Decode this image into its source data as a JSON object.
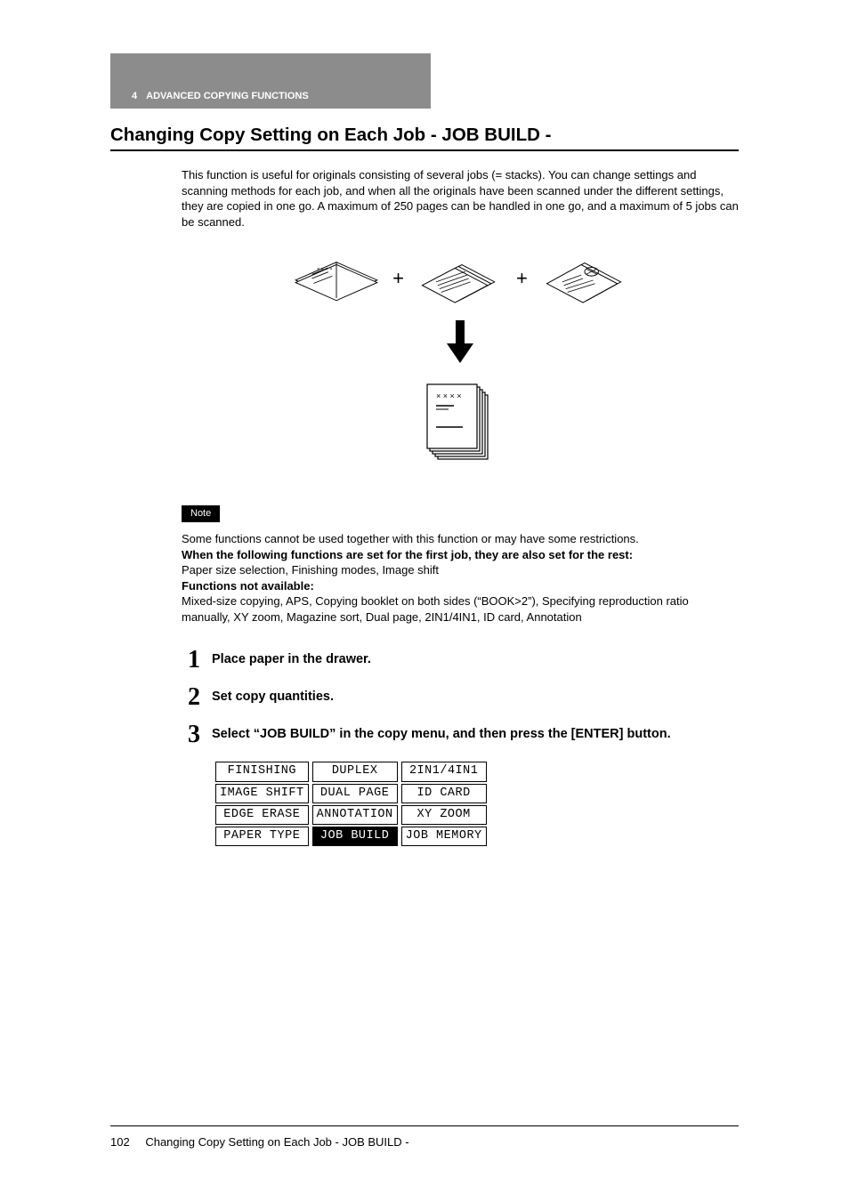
{
  "header": {
    "chapter_number": "4",
    "chapter_title": "ADVANCED COPYING FUNCTIONS"
  },
  "heading": "Changing Copy Setting on Each Job - JOB BUILD -",
  "intro": "This function is useful for originals consisting of several jobs (= stacks). You can change settings and scanning methods for each job, and when all the originals have been scanned under the different settings, they are copied in one go. A maximum of 250 pages can be handled in one go, and a maximum of 5 jobs can be scanned.",
  "illustration": {
    "plus": "+",
    "diagram_name": "job-build-flow-diagram"
  },
  "note": {
    "label": "Note",
    "line1": "Some functions cannot be used together with this function or may have some restrictions.",
    "bold1": "When the following functions are set for the first job, they are also set for the rest:",
    "line2": "Paper size selection, Finishing modes, Image shift",
    "bold2": "Functions not available:",
    "line3": "Mixed-size copying, APS, Copying booklet on both sides (“BOOK>2”), Specifying reproduction ratio manually, XY zoom, Magazine sort, Dual page, 2IN1/4IN1, ID card, Annotation"
  },
  "steps": [
    {
      "n": "1",
      "text": "Place paper in the drawer."
    },
    {
      "n": "2",
      "text": "Set copy quantities."
    },
    {
      "n": "3",
      "text": "Select “JOB BUILD” in the copy menu, and then press the [ENTER] button."
    }
  ],
  "menu_grid": {
    "rows": [
      [
        "FINISHING",
        "DUPLEX",
        "2IN1/4IN1"
      ],
      [
        "IMAGE SHIFT",
        "DUAL PAGE",
        "ID CARD"
      ],
      [
        "EDGE ERASE",
        "ANNOTATION",
        "XY ZOOM"
      ],
      [
        "PAPER TYPE",
        "JOB BUILD",
        "JOB MEMORY"
      ]
    ],
    "selected": {
      "row": 3,
      "col": 1
    }
  },
  "footer": {
    "page_number": "102",
    "running_title": "Changing Copy Setting on Each Job - JOB BUILD -"
  }
}
